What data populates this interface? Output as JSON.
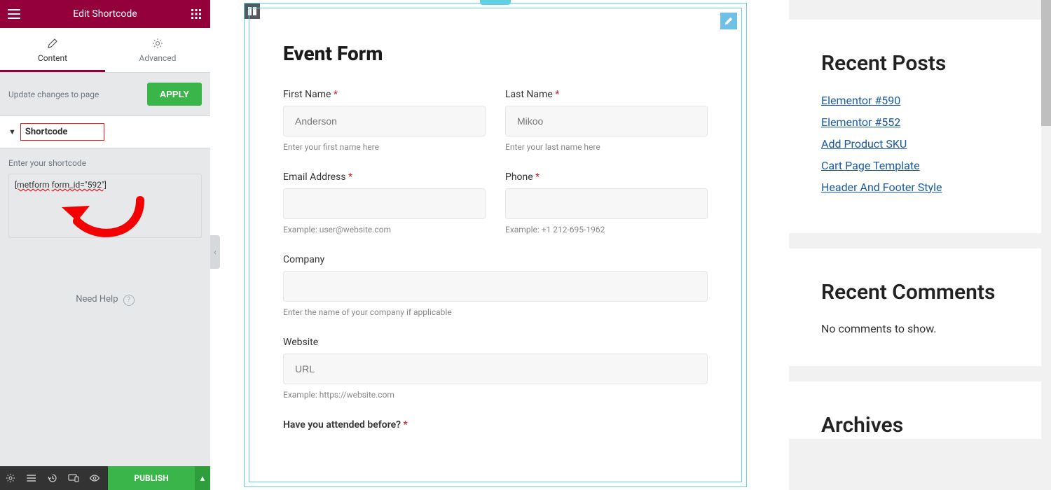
{
  "header": {
    "title": "Edit Shortcode"
  },
  "tabs": {
    "content": "Content",
    "advanced": "Advanced"
  },
  "apply": {
    "hint": "Update changes to page",
    "btn": "APPLY"
  },
  "section": {
    "label": "Shortcode"
  },
  "shortcode_field": {
    "label": "Enter your shortcode",
    "word1": "[metform",
    "word2": "form_id=\"592\"]"
  },
  "need_help": "Need Help",
  "publish": {
    "btn": "PUBLISH"
  },
  "form": {
    "title": "Event Form",
    "first_name": {
      "label": "First Name ",
      "placeholder": "Anderson",
      "help": "Enter your first name here"
    },
    "last_name": {
      "label": "Last Name ",
      "placeholder": "Mikoo",
      "help": "Enter your last name here"
    },
    "email": {
      "label": "Email Address ",
      "help": "Example: user@website.com"
    },
    "phone": {
      "label": "Phone ",
      "help": "Example: +1 212-695-1962"
    },
    "company": {
      "label": "Company",
      "help": "Enter the name of your company if applicable"
    },
    "website": {
      "label": "Website",
      "placeholder": "URL",
      "help": "Example: https://website.com"
    },
    "attended": {
      "label": "Have you attended before? "
    }
  },
  "right": {
    "recent_posts_h": "Recent Posts",
    "posts": {
      "p0": "Elementor #590",
      "p1": "Elementor #552",
      "p2": "Add Product SKU",
      "p3": "Cart Page Template",
      "p4": "Header And Footer Style"
    },
    "recent_comments_h": "Recent Comments",
    "no_comments": "No comments to show.",
    "archives_h": "Archives"
  },
  "asterisk": "*"
}
